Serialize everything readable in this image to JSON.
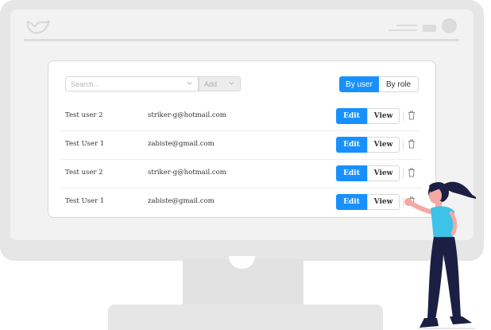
{
  "filters": {
    "search_placeholder": "Search...",
    "add_placeholder": "Add"
  },
  "toggle": {
    "by_user": "By user",
    "by_role": "By role",
    "selected": "By user"
  },
  "rows": [
    {
      "name": "Test user 2",
      "email": "striker-g@hotmail.com",
      "edit": "Edit",
      "view": "View"
    },
    {
      "name": "Test User 1",
      "email": "zabiste@gmail.com",
      "edit": "Edit",
      "view": "View"
    },
    {
      "name": "Test user 2",
      "email": "striker-g@hotmail.com",
      "edit": "Edit",
      "view": "View"
    },
    {
      "name": "Test User 1",
      "email": "zabiste@gmail.com",
      "edit": "Edit",
      "view": "View"
    }
  ],
  "colors": {
    "primary": "#1890ff",
    "monitor": "#e6e6e6",
    "screen": "#f2f2f2",
    "person_shirt": "#3dc2e8",
    "person_pants": "#1b1f44",
    "person_skin": "#f3a9a4"
  },
  "icons": [
    "logo-icon",
    "chevron-down-icon",
    "trash-icon",
    "window-menu-icon"
  ]
}
